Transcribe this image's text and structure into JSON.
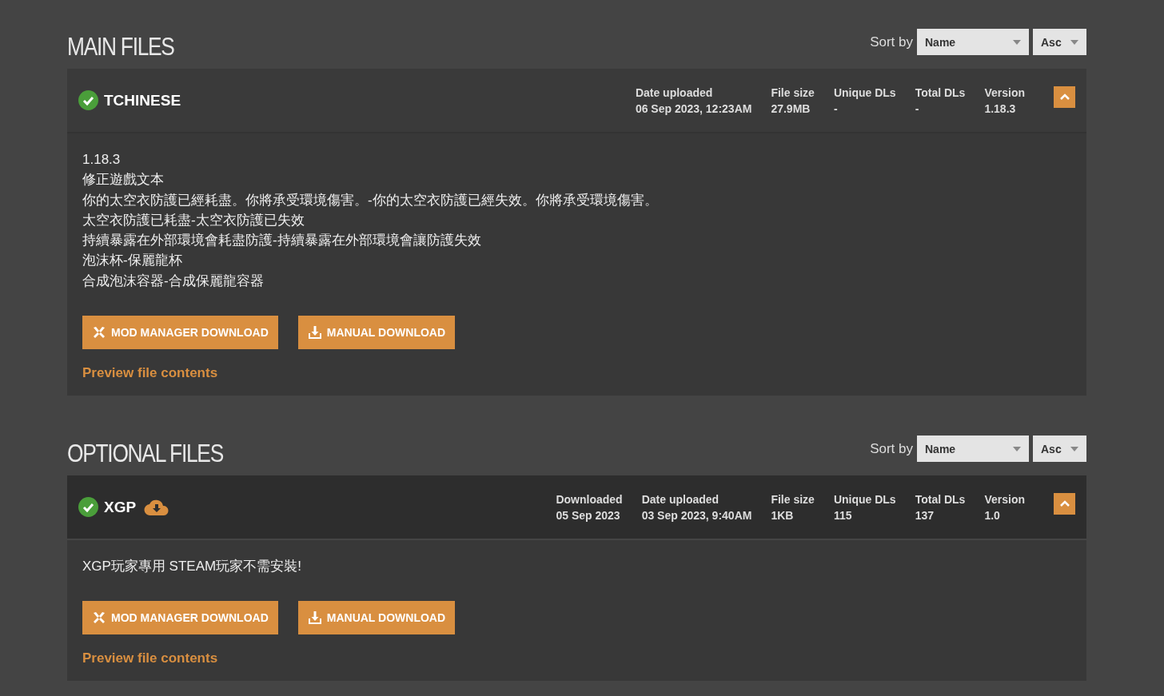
{
  "sections": [
    {
      "title": "MAIN FILES",
      "sort_label": "Sort by",
      "sort_field": "Name",
      "sort_order": "Asc",
      "files": [
        {
          "name": "TCHINESE",
          "verified": true,
          "downloaded": false,
          "expanded": true,
          "stats": [
            {
              "label": "Date uploaded",
              "value": "06 Sep 2023, 12:23AM"
            },
            {
              "label": "File size",
              "value": "27.9MB"
            },
            {
              "label": "Unique DLs",
              "value": "-"
            },
            {
              "label": "Total DLs",
              "value": "-"
            },
            {
              "label": "Version",
              "value": "1.18.3"
            }
          ],
          "description": [
            "1.18.3",
            "修正遊戲文本",
            "你的太空衣防護已經耗盡。你將承受環境傷害。-你的太空衣防護已經失效。你將承受環境傷害。",
            "太空衣防護已耗盡-太空衣防護已失效",
            "持續暴露在外部環境會耗盡防護-持續暴露在外部環境會讓防護失效",
            "泡沫杯-保麗龍杯",
            "合成泡沫容器-合成保麗龍容器"
          ],
          "buttons": [
            {
              "kind": "mod-manager",
              "label": "MOD MANAGER DOWNLOAD"
            },
            {
              "kind": "manual",
              "label": "MANUAL DOWNLOAD"
            }
          ],
          "preview_link": "Preview file contents"
        }
      ]
    },
    {
      "title": "OPTIONAL FILES",
      "sort_label": "Sort by",
      "sort_field": "Name",
      "sort_order": "Asc",
      "files": [
        {
          "name": "XGP",
          "verified": true,
          "downloaded": true,
          "expanded": true,
          "stats": [
            {
              "label": "Downloaded",
              "value": "05 Sep 2023"
            },
            {
              "label": "Date uploaded",
              "value": "03 Sep 2023, 9:40AM"
            },
            {
              "label": "File size",
              "value": "1KB"
            },
            {
              "label": "Unique DLs",
              "value": "115"
            },
            {
              "label": "Total DLs",
              "value": "137"
            },
            {
              "label": "Version",
              "value": "1.0"
            }
          ],
          "description": [
            "XGP玩家專用 STEAM玩家不需安裝!"
          ],
          "buttons": [
            {
              "kind": "mod-manager",
              "label": "MOD MANAGER DOWNLOAD"
            },
            {
              "kind": "manual",
              "label": "MANUAL DOWNLOAD"
            }
          ],
          "preview_link": "Preview file contents"
        }
      ]
    }
  ]
}
